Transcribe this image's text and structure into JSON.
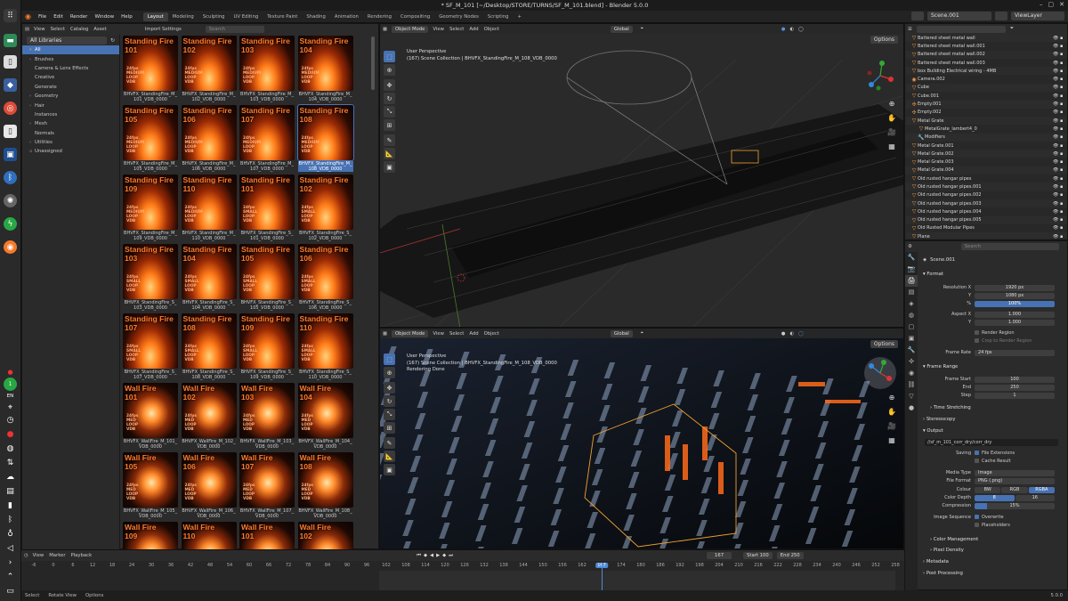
{
  "window": {
    "title": "* SF_M_101 [~/Desktop/STORE/TURNS/SF_M_101.blend] - Blender 5.0.0"
  },
  "menus": [
    "File",
    "Edit",
    "Render",
    "Window",
    "Help"
  ],
  "workspaces": [
    "Layout",
    "Modeling",
    "Sculpting",
    "UV Editing",
    "Texture Paint",
    "Shading",
    "Animation",
    "Rendering",
    "Compositing",
    "Geometry Nodes",
    "Scripting",
    "+"
  ],
  "scene": {
    "name": "Scene.001",
    "view_layer": "ViewLayer"
  },
  "asset_browser": {
    "header": [
      "View",
      "Select",
      "Catalog",
      "Asset"
    ],
    "import_settings": "Import Settings",
    "search_placeholder": "Search",
    "library": "All Libraries",
    "catalogs": [
      {
        "label": "All",
        "selected": true,
        "expand": "▾"
      },
      {
        "label": "Brushes",
        "expand": "›"
      },
      {
        "label": "Camera & Lens Effects",
        "expand": ""
      },
      {
        "label": "Creative",
        "expand": ""
      },
      {
        "label": "Generate",
        "expand": ""
      },
      {
        "label": "Geometry",
        "expand": "›"
      },
      {
        "label": "Hair",
        "expand": "›"
      },
      {
        "label": "Instances",
        "expand": ""
      },
      {
        "label": "Mesh",
        "expand": "›"
      },
      {
        "label": "Normals",
        "expand": ""
      },
      {
        "label": "Utilities",
        "expand": "›"
      },
      {
        "label": "Unassigned",
        "expand": "▫"
      }
    ],
    "assets": [
      {
        "t1": "Standing Fire",
        "t2": "101",
        "m1": "24fps",
        "m2": "MEDIUM",
        "m3": "LOOP",
        "m4": "VDB",
        "cap1": "BHVFX_StandingFire_M_",
        "cap2": "101_VDB_0000",
        "kind": "fire"
      },
      {
        "t1": "Standing Fire",
        "t2": "102",
        "m1": "24fps",
        "m2": "MEDIUM",
        "m3": "LOOP",
        "m4": "VDB",
        "cap1": "BHVFX_StandingFire_M_",
        "cap2": "102_VDB_0000",
        "kind": "fire"
      },
      {
        "t1": "Standing Fire",
        "t2": "103",
        "m1": "24fps",
        "m2": "MEDIUM",
        "m3": "LOOP",
        "m4": "VDB",
        "cap1": "BHVFX_StandingFire_M_",
        "cap2": "103_VDB_0000",
        "kind": "fire"
      },
      {
        "t1": "Standing Fire",
        "t2": "104",
        "m1": "24fps",
        "m2": "MEDIUM",
        "m3": "LOOP",
        "m4": "VDB",
        "cap1": "BHVFX_StandingFire_M_",
        "cap2": "104_VDB_0000",
        "kind": "fire"
      },
      {
        "t1": "Standing Fire",
        "t2": "105",
        "m1": "24fps",
        "m2": "MEDIUM",
        "m3": "LOOP",
        "m4": "VDB",
        "cap1": "BHVFX_StandingFire_M_",
        "cap2": "105_VDB_0000",
        "kind": "fire"
      },
      {
        "t1": "Standing Fire",
        "t2": "106",
        "m1": "24fps",
        "m2": "MEDIUM",
        "m3": "LOOP",
        "m4": "VDB",
        "cap1": "BHVFX_StandingFire_M_",
        "cap2": "106_VDB_0000",
        "kind": "fire"
      },
      {
        "t1": "Standing Fire",
        "t2": "107",
        "m1": "24fps",
        "m2": "MEDIUM",
        "m3": "LOOP",
        "m4": "VDB",
        "cap1": "BHVFX_StandingFire_M_",
        "cap2": "107_VDB_0000",
        "kind": "fire"
      },
      {
        "t1": "Standing Fire",
        "t2": "108",
        "m1": "24fps",
        "m2": "MEDIUM",
        "m3": "LOOP",
        "m4": "VDB",
        "cap1": "BHVFX_StandingFire_M_",
        "cap2": "108_VDB_0000",
        "kind": "fire",
        "selected": true
      },
      {
        "t1": "Standing Fire",
        "t2": "109",
        "m1": "24fps",
        "m2": "MEDIUM",
        "m3": "LOOP",
        "m4": "VDB",
        "cap1": "BHVFX_StandingFire_M_",
        "cap2": "109_VDB_0000",
        "kind": "fire"
      },
      {
        "t1": "Standing Fire",
        "t2": "110",
        "m1": "24fps",
        "m2": "MEDIUM",
        "m3": "LOOP",
        "m4": "VDB",
        "cap1": "BHVFX_StandingFire_M_",
        "cap2": "110_VDB_0000",
        "kind": "fire"
      },
      {
        "t1": "Standing Fire",
        "t2": "101",
        "m1": "24fps",
        "m2": "SMALL",
        "m3": "LOOP",
        "m4": "VDB",
        "cap1": "BHVFX_StandingFire_S_",
        "cap2": "101_VDB_0000",
        "kind": "fire"
      },
      {
        "t1": "Standing Fire",
        "t2": "102",
        "m1": "24fps",
        "m2": "SMALL",
        "m3": "LOOP",
        "m4": "VDB",
        "cap1": "BHVFX_StandingFire_S_",
        "cap2": "102_VDB_0000",
        "kind": "fire"
      },
      {
        "t1": "Standing Fire",
        "t2": "103",
        "m1": "24fps",
        "m2": "SMALL",
        "m3": "LOOP",
        "m4": "VDB",
        "cap1": "BHVFX_StandingFire_S_",
        "cap2": "103_VDB_0000",
        "kind": "fire"
      },
      {
        "t1": "Standing Fire",
        "t2": "104",
        "m1": "24fps",
        "m2": "SMALL",
        "m3": "LOOP",
        "m4": "VDB",
        "cap1": "BHVFX_StandingFire_S_",
        "cap2": "104_VDB_0000",
        "kind": "fire"
      },
      {
        "t1": "Standing Fire",
        "t2": "105",
        "m1": "24fps",
        "m2": "SMALL",
        "m3": "LOOP",
        "m4": "VDB",
        "cap1": "BHVFX_StandingFire_S_",
        "cap2": "105_VDB_0000",
        "kind": "fire"
      },
      {
        "t1": "Standing Fire",
        "t2": "106",
        "m1": "24fps",
        "m2": "SMALL",
        "m3": "LOOP",
        "m4": "VDB",
        "cap1": "BHVFX_StandingFire_S_",
        "cap2": "106_VDB_0000",
        "kind": "fire"
      },
      {
        "t1": "Standing Fire",
        "t2": "107",
        "m1": "24fps",
        "m2": "SMALL",
        "m3": "LOOP",
        "m4": "VDB",
        "cap1": "BHVFX_StandingFire_S_",
        "cap2": "107_VDB_0000",
        "kind": "fire"
      },
      {
        "t1": "Standing Fire",
        "t2": "108",
        "m1": "24fps",
        "m2": "SMALL",
        "m3": "LOOP",
        "m4": "VDB",
        "cap1": "BHVFX_StandingFire_S_",
        "cap2": "108_VDB_0000",
        "kind": "fire"
      },
      {
        "t1": "Standing Fire",
        "t2": "109",
        "m1": "24fps",
        "m2": "SMALL",
        "m3": "LOOP",
        "m4": "VDB",
        "cap1": "BHVFX_StandingFire_S_",
        "cap2": "109_VDB_0000",
        "kind": "fire"
      },
      {
        "t1": "Standing Fire",
        "t2": "110",
        "m1": "24fps",
        "m2": "SMALL",
        "m3": "LOOP",
        "m4": "VDB",
        "cap1": "BHVFX_StandingFire_S_",
        "cap2": "110_VDB_0000",
        "kind": "fire"
      },
      {
        "t1": "Wall Fire",
        "t2": "101",
        "m1": "24fps",
        "m2": "MED",
        "m3": "LOOP",
        "m4": "VDB",
        "cap1": "BHVFX_WallFire_M_101_",
        "cap2": "VDB_0000",
        "kind": "wall"
      },
      {
        "t1": "Wall Fire",
        "t2": "102",
        "m1": "24fps",
        "m2": "MED",
        "m3": "LOOP",
        "m4": "VDB",
        "cap1": "BHVFX_WallFire_M_102_",
        "cap2": "VDB_0000",
        "kind": "wall"
      },
      {
        "t1": "Wall Fire",
        "t2": "103",
        "m1": "24fps",
        "m2": "MED",
        "m3": "LOOP",
        "m4": "VDB",
        "cap1": "BHVFX_WallFire_M_103_",
        "cap2": "VDB_0000",
        "kind": "wall"
      },
      {
        "t1": "Wall Fire",
        "t2": "104",
        "m1": "24fps",
        "m2": "MED",
        "m3": "LOOP",
        "m4": "VDB",
        "cap1": "BHVFX_WallFire_M_104_",
        "cap2": "VDB_0000",
        "kind": "wall"
      },
      {
        "t1": "Wall Fire",
        "t2": "105",
        "m1": "24fps",
        "m2": "MED",
        "m3": "LOOP",
        "m4": "VDB",
        "cap1": "BHVFX_WallFire_M_105_",
        "cap2": "VDB_0000",
        "kind": "wall"
      },
      {
        "t1": "Wall Fire",
        "t2": "106",
        "m1": "24fps",
        "m2": "MED",
        "m3": "LOOP",
        "m4": "VDB",
        "cap1": "BHVFX_WallFire_M_106_",
        "cap2": "VDB_0000",
        "kind": "wall"
      },
      {
        "t1": "Wall Fire",
        "t2": "107",
        "m1": "24fps",
        "m2": "MED",
        "m3": "LOOP",
        "m4": "VDB",
        "cap1": "BHVFX_WallFire_M_107_",
        "cap2": "VDB_0000",
        "kind": "wall"
      },
      {
        "t1": "Wall Fire",
        "t2": "108",
        "m1": "24fps",
        "m2": "MED",
        "m3": "LOOP",
        "m4": "VDB",
        "cap1": "BHVFX_WallFire_M_108_",
        "cap2": "VDB_0000",
        "kind": "wall"
      },
      {
        "t1": "Wall Fire",
        "t2": "109",
        "m1": "",
        "m2": "",
        "m3": "",
        "m4": "",
        "cap1": "",
        "cap2": "",
        "kind": "wall"
      },
      {
        "t1": "Wall Fire",
        "t2": "110",
        "m1": "",
        "m2": "",
        "m3": "",
        "m4": "",
        "cap1": "",
        "cap2": "",
        "kind": "wall"
      },
      {
        "t1": "Wall Fire",
        "t2": "101",
        "m1": "",
        "m2": "",
        "m3": "",
        "m4": "",
        "cap1": "",
        "cap2": "",
        "kind": "wall"
      },
      {
        "t1": "Wall Fire",
        "t2": "102",
        "m1": "",
        "m2": "",
        "m3": "",
        "m4": "",
        "cap1": "",
        "cap2": "",
        "kind": "wall"
      }
    ]
  },
  "viewport_top": {
    "mode": "Object Mode",
    "menu": [
      "View",
      "Select",
      "Add",
      "Object"
    ],
    "transform": "Global",
    "options": "Options",
    "info1": "User Perspective",
    "info2": "(167) Scene Collection | BHVFX_StandingFire_M_108_VDB_0000"
  },
  "viewport_bottom": {
    "mode": "Object Mode",
    "menu": [
      "View",
      "Select",
      "Add",
      "Object"
    ],
    "transform": "Global",
    "options": "Options",
    "info1": "User Perspective",
    "info2": "(167) Scene Collection | BHVFX_StandingFire_M_108_VDB_0000",
    "info3": "Rendering Done"
  },
  "outliner": {
    "items": [
      {
        "label": "Battered sheet metal wall",
        "icon": "▽"
      },
      {
        "label": "Battered sheet metal wall.001",
        "icon": "▽"
      },
      {
        "label": "Battered sheet metal wall.002",
        "icon": "▽"
      },
      {
        "label": "Battered sheet metal wall.003",
        "icon": "▽"
      },
      {
        "label": "box Building Electrical wiring - 4MB",
        "icon": "▽"
      },
      {
        "label": "Camera.002",
        "icon": "◉"
      },
      {
        "label": "Cube",
        "icon": "▽"
      },
      {
        "label": "Cube.001",
        "icon": "▽"
      },
      {
        "label": "Empty.001",
        "icon": "✣"
      },
      {
        "label": "Empty.002",
        "icon": "✣"
      },
      {
        "label": "Metal Grate",
        "icon": "▽"
      },
      {
        "label": "MetalGrate_lambert4_0",
        "icon": "▽"
      },
      {
        "label": "Modifiers",
        "icon": "🔧"
      },
      {
        "label": "Metal Grate.001",
        "icon": "▽"
      },
      {
        "label": "Metal Grate.002",
        "icon": "▽"
      },
      {
        "label": "Metal Grate.003",
        "icon": "▽"
      },
      {
        "label": "Metal Grate.004",
        "icon": "▽"
      },
      {
        "label": "Old rusted hangar pipes",
        "icon": "▽"
      },
      {
        "label": "Old rusted hangar pipes.001",
        "icon": "▽"
      },
      {
        "label": "Old rusted hangar pipes.002",
        "icon": "▽"
      },
      {
        "label": "Old rusted hangar pipes.003",
        "icon": "▽"
      },
      {
        "label": "Old rusted hangar pipes.004",
        "icon": "▽"
      },
      {
        "label": "Old rusted hangar pipes.005",
        "icon": "▽"
      },
      {
        "label": "Old Rusted Modular Pipes",
        "icon": "▽"
      },
      {
        "label": "Plane",
        "icon": "▽"
      }
    ]
  },
  "properties": {
    "search_placeholder": "Search",
    "scene": "Scene.001",
    "format": "Format",
    "resolution_label": "Resolution X",
    "res_x": "1920 px",
    "y_label": "Y",
    "res_y": "1080 px",
    "pct_label": "%",
    "res_pct": "100%",
    "aspect_label": "Aspect X",
    "aspect_x": "1.000",
    "aspect_y": "1.000",
    "render_region": "Render Region",
    "crop": "Crop to Render Region",
    "frame_rate_label": "Frame Rate",
    "frame_rate": "24 fps",
    "frame_range": "Frame Range",
    "frame_start_label": "Frame Start",
    "frame_start": "100",
    "end_label": "End",
    "frame_end": "250",
    "step_label": "Step",
    "step": "1",
    "time_stretching": "Time Stretching",
    "stereoscopy": "Stereoscopy",
    "output": "Output",
    "output_path": "//sf_m_101_corr_dry/corr_dry",
    "saving_label": "Saving",
    "file_ext": "File Extensions",
    "cache_result": "Cache Result",
    "media_type_label": "Media Type",
    "media_type": "Image",
    "file_format_label": "File Format",
    "file_format": "PNG (.png)",
    "colour_label": "Colour",
    "colour_opts": [
      "BW",
      "RGB",
      "RGBA"
    ],
    "depth_label": "Color Depth",
    "depth_opts": [
      "8",
      "16"
    ],
    "compression_label": "Compression",
    "compression": "15%",
    "compression_value": 0.15,
    "img_seq_label": "Image Sequence",
    "overwrite": "Overwrite",
    "placeholders": "Placeholders",
    "color_management": "Color Management",
    "pixel_density": "Pixel Density",
    "metadata": "Metadata",
    "post_processing": "Post Processing"
  },
  "timeline": {
    "menu": [
      "View",
      "Marker",
      "Playback"
    ],
    "current_frame": "167",
    "start_label": "Start",
    "start": "100",
    "end_label": "End",
    "end": "250",
    "ticks": [
      "-6",
      "0",
      "6",
      "12",
      "18",
      "24",
      "30",
      "36",
      "42",
      "48",
      "54",
      "60",
      "66",
      "72",
      "78",
      "84",
      "90",
      "96",
      "102",
      "108",
      "114",
      "120",
      "126",
      "132",
      "138",
      "144",
      "150",
      "156",
      "162",
      "167",
      "174",
      "180",
      "186",
      "192",
      "198",
      "204",
      "210",
      "216",
      "222",
      "228",
      "234",
      "240",
      "246",
      "252",
      "258"
    ]
  },
  "status_bar": {
    "select": "Select",
    "rotate": "Rotate View",
    "options": "Options",
    "version": "5.0.0"
  },
  "tray": {
    "lang": "EN"
  },
  "colors": {
    "accent": "#4772b3",
    "fire": "#ff7b2c"
  }
}
